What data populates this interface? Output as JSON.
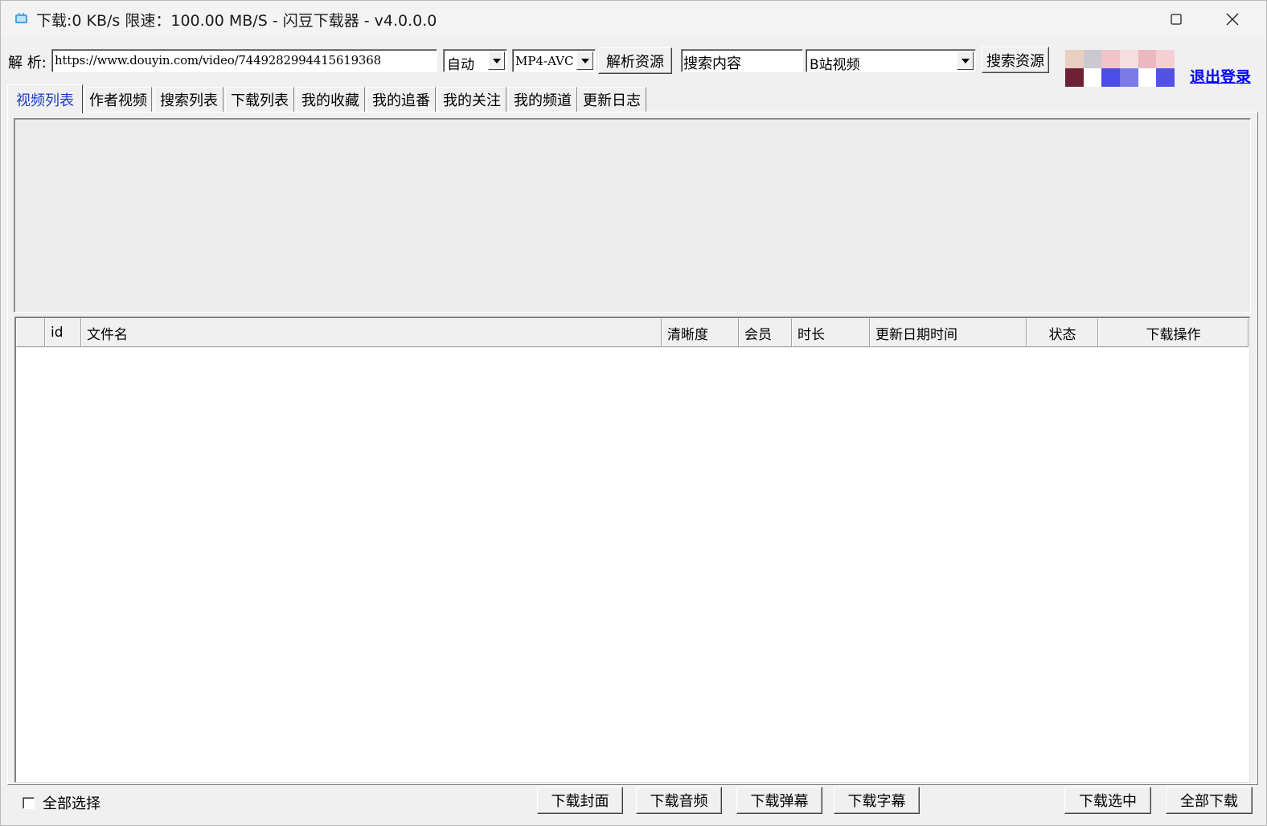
{
  "window": {
    "title": "下载:0 KB/s  限速：100.00 MB/S  - 闪豆下载器 - v4.0.0.0",
    "maximize_glyph": "☐",
    "close_glyph": "✕"
  },
  "toolbar": {
    "parse_label": "解 析:",
    "url_value": "https://www.douyin.com/video/7449282994415619368",
    "quality_select": "自动",
    "format_select": "MP4-AVC",
    "parse_button": "解析资源",
    "search_input_value": "搜索内容",
    "site_select": "B站视频",
    "search_button": "搜索资源",
    "logout_link": "退出登录"
  },
  "avatar_colors": [
    "#e8cfc0",
    "#c9c9cf",
    "#f3c3cc",
    "#f6dde0",
    "#ecb8c0",
    "#f4d0d5",
    "#6e2034",
    "#ffffff",
    "#4c4ce6",
    "#7a7ae8",
    "#ffffff",
    "#5252e6"
  ],
  "tabs": [
    {
      "label": "视频列表",
      "active": true
    },
    {
      "label": "作者视频",
      "active": false
    },
    {
      "label": "搜索列表",
      "active": false
    },
    {
      "label": "下载列表",
      "active": false
    },
    {
      "label": "我的收藏",
      "active": false
    },
    {
      "label": "我的追番",
      "active": false
    },
    {
      "label": "我的关注",
      "active": false
    },
    {
      "label": "我的频道",
      "active": false
    },
    {
      "label": "更新日志",
      "active": false
    }
  ],
  "table": {
    "columns": [
      "",
      "id",
      "文件名",
      "清晰度",
      "会员",
      "时长",
      "更新日期时间",
      "状态",
      "下载操作"
    ],
    "rows": []
  },
  "bottom": {
    "select_all": "全部选择",
    "download_cover": "下载封面",
    "download_audio": "下载音频",
    "download_danmaku": "下载弹幕",
    "download_subtitle": "下载字幕",
    "download_selected": "下载选中",
    "download_all": "全部下载"
  },
  "colors": {
    "active_tab": "#1a3fbf",
    "link": "#0000ff",
    "panel_bg": "#f0f0f0"
  }
}
